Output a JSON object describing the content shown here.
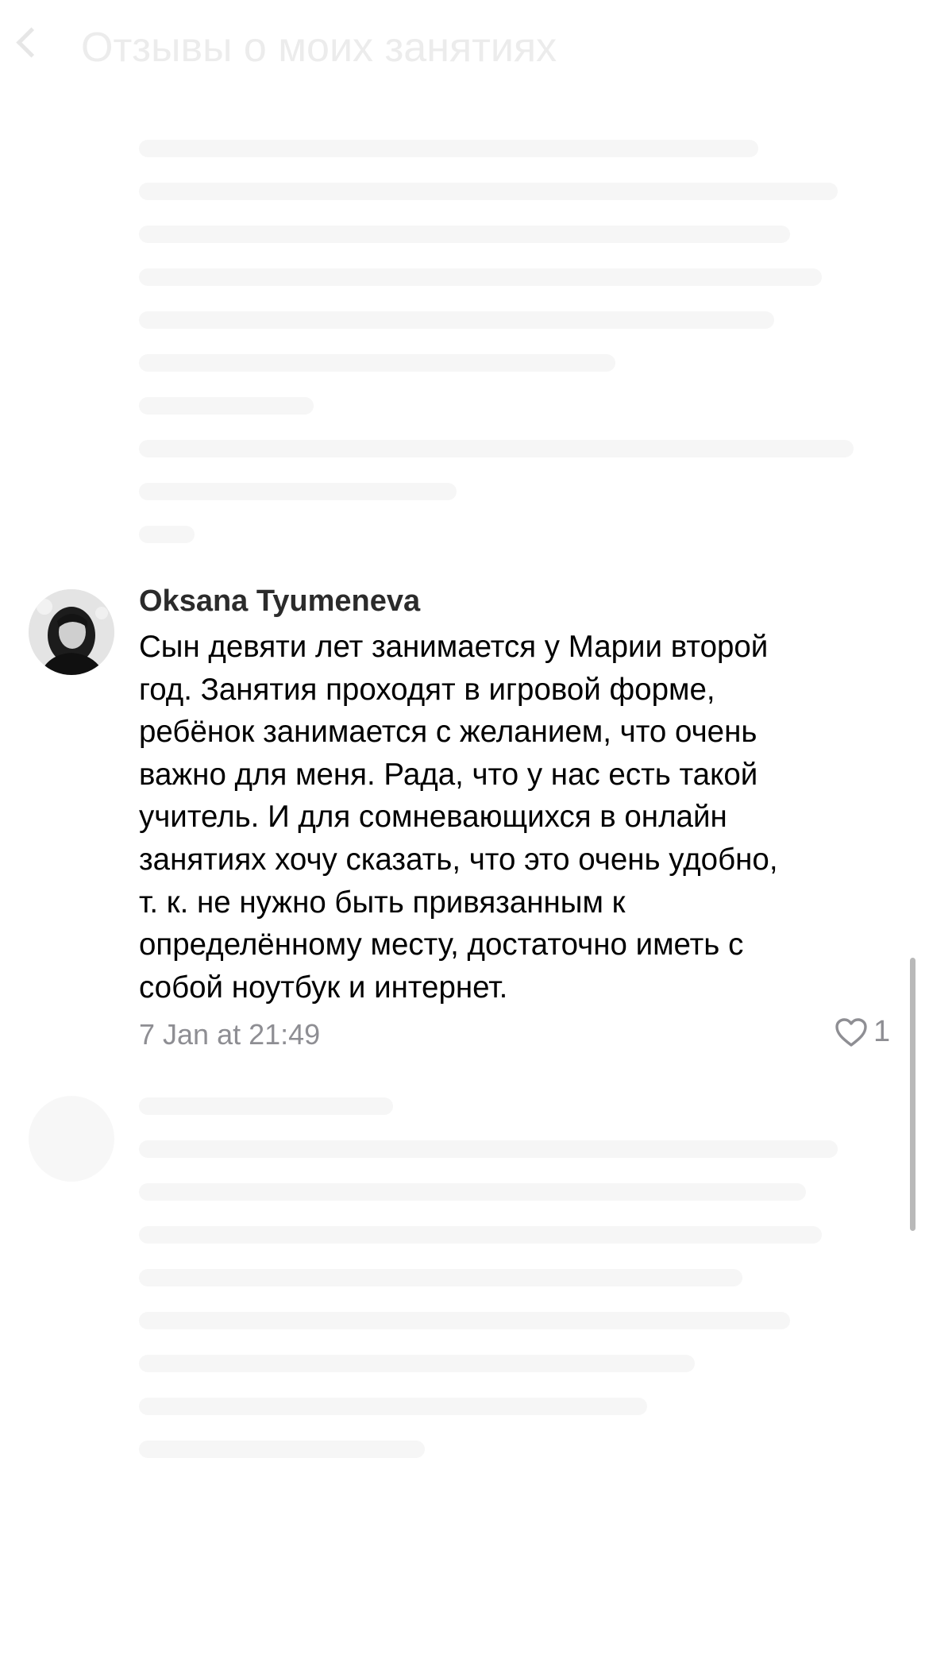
{
  "header": {
    "title": "Отзывы о моих занятиях"
  },
  "comment": {
    "author": "Oksana Tyumeneva",
    "text_lines": [
      "Сын девяти лет занимается у Марии второй",
      "год. Занятия проходят в игровой форме,",
      "ребёнок занимается с желанием, что очень",
      "важно для меня. Рада, что у нас есть такой",
      "учитель. И для сомневающихся в онлайн",
      "занятиях хочу сказать, что это очень удобно,",
      "т. к. не нужно быть привязанным к",
      "определённому месту, достаточно иметь с",
      "собой ноутбук и интернет."
    ],
    "timestamp": "7 Jan at 21:49",
    "likes": "1"
  },
  "colors": {
    "text": "#000000",
    "author": "#2b2b2b",
    "meta": "#8e8e93"
  },
  "icons": {
    "like": "heart-outline-icon"
  }
}
